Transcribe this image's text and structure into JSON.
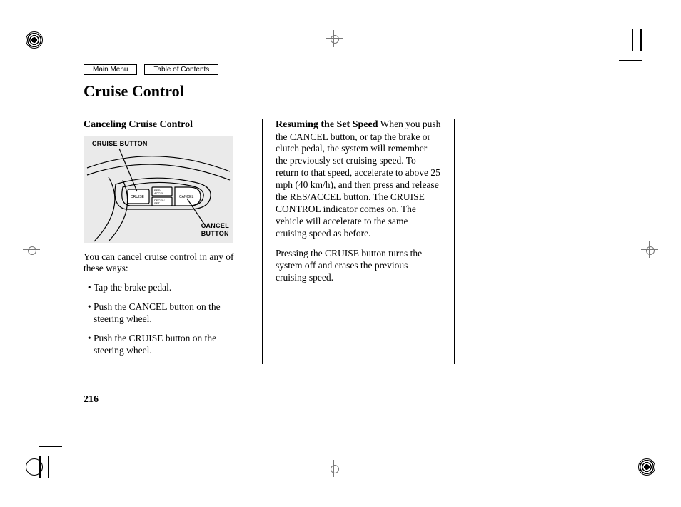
{
  "nav": {
    "main_menu": "Main Menu",
    "toc": "Table of Contents"
  },
  "title": "Cruise Control",
  "col1": {
    "subhead": "Canceling Cruise Control",
    "diagram": {
      "label_top": "CRUISE BUTTON",
      "label_bottom": "CANCEL\nBUTTON",
      "btn_cruise": "CRUISE",
      "btn_res": "RES/\nACCEL",
      "btn_set": "DECEL/\nSET",
      "btn_cancel": "CANCEL"
    },
    "intro": "You can cancel cruise control in any of these ways:",
    "bullets": [
      "Tap the brake pedal.",
      "Push the CANCEL button on the steering wheel.",
      "Push the CRUISE button on the steering wheel."
    ]
  },
  "col2": {
    "subhead": "Resuming the Set Speed",
    "p1": "When you push the CANCEL button, or tap the brake or clutch pedal, the system will remember the previously set cruising speed. To return to that speed, accelerate to above 25 mph (40 km/h), and then press and release the RES/ACCEL button. The CRUISE CONTROL indicator comes on. The vehicle will accelerate to the same cruising speed as before.",
    "p2": "Pressing the CRUISE button turns the system off and erases the previous cruising speed."
  },
  "page_number": "216"
}
